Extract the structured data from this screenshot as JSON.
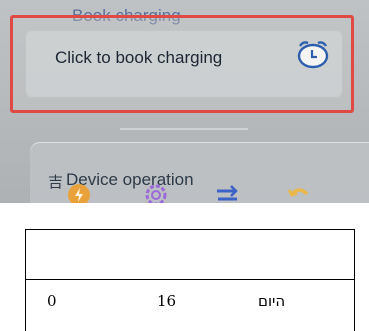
{
  "app": {
    "section_title": "Book charging",
    "booking": {
      "prompt": "Click to book charging",
      "icon": "alarm-clock-icon",
      "highlight_color": "#e04a45"
    },
    "device_operation": {
      "glyph": "吉",
      "label": "Device operation",
      "buttons": [
        {
          "icon": "power-icon",
          "color": "#e9a23b"
        },
        {
          "icon": "settings-icon",
          "color": "#9b6ad8"
        },
        {
          "icon": "switch-icon",
          "color": "#3b62c6"
        },
        {
          "icon": "return-icon",
          "color": "#e9b84a"
        }
      ]
    }
  },
  "table": {
    "header": "",
    "row": [
      "0",
      "16",
      "היום"
    ]
  }
}
